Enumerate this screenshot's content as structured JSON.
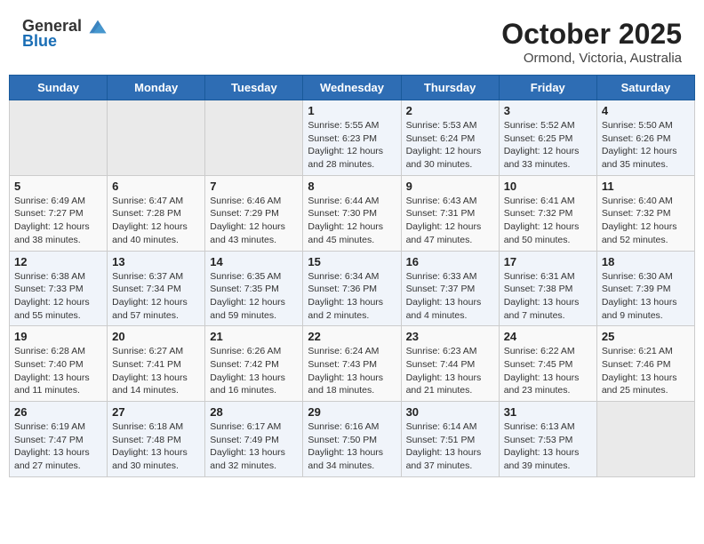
{
  "header": {
    "logo_general": "General",
    "logo_blue": "Blue",
    "month": "October 2025",
    "location": "Ormond, Victoria, Australia"
  },
  "days_of_week": [
    "Sunday",
    "Monday",
    "Tuesday",
    "Wednesday",
    "Thursday",
    "Friday",
    "Saturday"
  ],
  "weeks": [
    [
      {
        "day": "",
        "info": ""
      },
      {
        "day": "",
        "info": ""
      },
      {
        "day": "",
        "info": ""
      },
      {
        "day": "1",
        "info": "Sunrise: 5:55 AM\nSunset: 6:23 PM\nDaylight: 12 hours and 28 minutes."
      },
      {
        "day": "2",
        "info": "Sunrise: 5:53 AM\nSunset: 6:24 PM\nDaylight: 12 hours and 30 minutes."
      },
      {
        "day": "3",
        "info": "Sunrise: 5:52 AM\nSunset: 6:25 PM\nDaylight: 12 hours and 33 minutes."
      },
      {
        "day": "4",
        "info": "Sunrise: 5:50 AM\nSunset: 6:26 PM\nDaylight: 12 hours and 35 minutes."
      }
    ],
    [
      {
        "day": "5",
        "info": "Sunrise: 6:49 AM\nSunset: 7:27 PM\nDaylight: 12 hours and 38 minutes."
      },
      {
        "day": "6",
        "info": "Sunrise: 6:47 AM\nSunset: 7:28 PM\nDaylight: 12 hours and 40 minutes."
      },
      {
        "day": "7",
        "info": "Sunrise: 6:46 AM\nSunset: 7:29 PM\nDaylight: 12 hours and 43 minutes."
      },
      {
        "day": "8",
        "info": "Sunrise: 6:44 AM\nSunset: 7:30 PM\nDaylight: 12 hours and 45 minutes."
      },
      {
        "day": "9",
        "info": "Sunrise: 6:43 AM\nSunset: 7:31 PM\nDaylight: 12 hours and 47 minutes."
      },
      {
        "day": "10",
        "info": "Sunrise: 6:41 AM\nSunset: 7:32 PM\nDaylight: 12 hours and 50 minutes."
      },
      {
        "day": "11",
        "info": "Sunrise: 6:40 AM\nSunset: 7:32 PM\nDaylight: 12 hours and 52 minutes."
      }
    ],
    [
      {
        "day": "12",
        "info": "Sunrise: 6:38 AM\nSunset: 7:33 PM\nDaylight: 12 hours and 55 minutes."
      },
      {
        "day": "13",
        "info": "Sunrise: 6:37 AM\nSunset: 7:34 PM\nDaylight: 12 hours and 57 minutes."
      },
      {
        "day": "14",
        "info": "Sunrise: 6:35 AM\nSunset: 7:35 PM\nDaylight: 12 hours and 59 minutes."
      },
      {
        "day": "15",
        "info": "Sunrise: 6:34 AM\nSunset: 7:36 PM\nDaylight: 13 hours and 2 minutes."
      },
      {
        "day": "16",
        "info": "Sunrise: 6:33 AM\nSunset: 7:37 PM\nDaylight: 13 hours and 4 minutes."
      },
      {
        "day": "17",
        "info": "Sunrise: 6:31 AM\nSunset: 7:38 PM\nDaylight: 13 hours and 7 minutes."
      },
      {
        "day": "18",
        "info": "Sunrise: 6:30 AM\nSunset: 7:39 PM\nDaylight: 13 hours and 9 minutes."
      }
    ],
    [
      {
        "day": "19",
        "info": "Sunrise: 6:28 AM\nSunset: 7:40 PM\nDaylight: 13 hours and 11 minutes."
      },
      {
        "day": "20",
        "info": "Sunrise: 6:27 AM\nSunset: 7:41 PM\nDaylight: 13 hours and 14 minutes."
      },
      {
        "day": "21",
        "info": "Sunrise: 6:26 AM\nSunset: 7:42 PM\nDaylight: 13 hours and 16 minutes."
      },
      {
        "day": "22",
        "info": "Sunrise: 6:24 AM\nSunset: 7:43 PM\nDaylight: 13 hours and 18 minutes."
      },
      {
        "day": "23",
        "info": "Sunrise: 6:23 AM\nSunset: 7:44 PM\nDaylight: 13 hours and 21 minutes."
      },
      {
        "day": "24",
        "info": "Sunrise: 6:22 AM\nSunset: 7:45 PM\nDaylight: 13 hours and 23 minutes."
      },
      {
        "day": "25",
        "info": "Sunrise: 6:21 AM\nSunset: 7:46 PM\nDaylight: 13 hours and 25 minutes."
      }
    ],
    [
      {
        "day": "26",
        "info": "Sunrise: 6:19 AM\nSunset: 7:47 PM\nDaylight: 13 hours and 27 minutes."
      },
      {
        "day": "27",
        "info": "Sunrise: 6:18 AM\nSunset: 7:48 PM\nDaylight: 13 hours and 30 minutes."
      },
      {
        "day": "28",
        "info": "Sunrise: 6:17 AM\nSunset: 7:49 PM\nDaylight: 13 hours and 32 minutes."
      },
      {
        "day": "29",
        "info": "Sunrise: 6:16 AM\nSunset: 7:50 PM\nDaylight: 13 hours and 34 minutes."
      },
      {
        "day": "30",
        "info": "Sunrise: 6:14 AM\nSunset: 7:51 PM\nDaylight: 13 hours and 37 minutes."
      },
      {
        "day": "31",
        "info": "Sunrise: 6:13 AM\nSunset: 7:53 PM\nDaylight: 13 hours and 39 minutes."
      },
      {
        "day": "",
        "info": ""
      }
    ]
  ]
}
